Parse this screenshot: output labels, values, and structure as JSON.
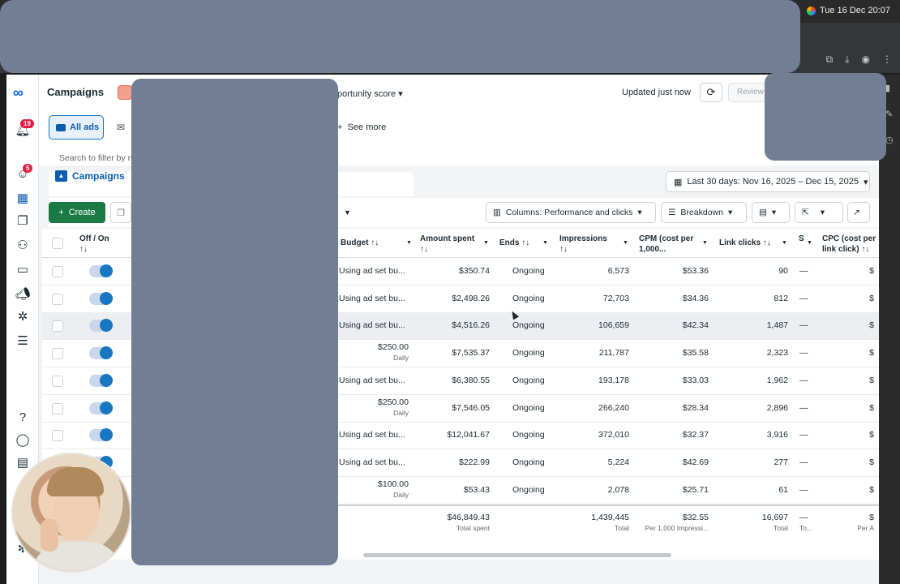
{
  "system": {
    "clock": "Tue 16 Dec  20:07"
  },
  "header": {
    "title": "Campaigns",
    "opportunity_label": "portunity score",
    "updated_label": "Updated just now",
    "review_label": "Review"
  },
  "filters": {
    "all_ads_label": "All ads",
    "see_more_label": "See more",
    "search_placeholder": "Search to filter by n"
  },
  "rail": {
    "notification_count": "19",
    "alerts_count": "5"
  },
  "tabs": {
    "campaigns_label": "Campaigns"
  },
  "date_range": {
    "label": "Last 30 days: Nov 16, 2025 – Dec 15, 2025"
  },
  "toolbar": {
    "create_label": "Create",
    "columns_label": "Columns: Performance and clicks",
    "breakdown_label": "Breakdown"
  },
  "table": {
    "headers": {
      "off_on": "Off / On",
      "budget": "Budget",
      "amount_spent": "Amount spent",
      "ends": "Ends",
      "impressions": "Impressions",
      "cpm": "CPM (cost per 1,000...",
      "link_clicks": "Link clicks",
      "s": "S",
      "cpc": "CPC (cost per link click)"
    },
    "sort_glyph": "↑↓",
    "rows": [
      {
        "budget": "Using ad set bu...",
        "budget_sub": "",
        "amount_spent": "$350.74",
        "ends": "Ongoing",
        "impressions": "6,573",
        "cpm": "$53.36",
        "link_clicks": "90",
        "s": "—",
        "cpc": "$",
        "highlighted": false
      },
      {
        "budget": "Using ad set bu...",
        "budget_sub": "",
        "amount_spent": "$2,498.26",
        "ends": "Ongoing",
        "impressions": "72,703",
        "cpm": "$34.36",
        "link_clicks": "812",
        "s": "—",
        "cpc": "$",
        "highlighted": false
      },
      {
        "budget": "Using ad set bu...",
        "budget_sub": "",
        "amount_spent": "$4,516.26",
        "ends": "Ongoing",
        "impressions": "106,659",
        "cpm": "$42.34",
        "link_clicks": "1,487",
        "s": "—",
        "cpc": "$",
        "highlighted": true
      },
      {
        "budget": "$250.00",
        "budget_sub": "Daily",
        "amount_spent": "$7,535.37",
        "ends": "Ongoing",
        "impressions": "211,787",
        "cpm": "$35.58",
        "link_clicks": "2,323",
        "s": "—",
        "cpc": "$",
        "highlighted": false
      },
      {
        "budget": "Using ad set bu...",
        "budget_sub": "",
        "amount_spent": "$6,380.55",
        "ends": "Ongoing",
        "impressions": "193,178",
        "cpm": "$33.03",
        "link_clicks": "1,962",
        "s": "—",
        "cpc": "$",
        "highlighted": false
      },
      {
        "budget": "$250.00",
        "budget_sub": "Daily",
        "amount_spent": "$7,546.05",
        "ends": "Ongoing",
        "impressions": "266,240",
        "cpm": "$28.34",
        "link_clicks": "2,896",
        "s": "—",
        "cpc": "$",
        "highlighted": false
      },
      {
        "budget": "Using ad set bu...",
        "budget_sub": "",
        "amount_spent": "$12,041.67",
        "ends": "Ongoing",
        "impressions": "372,010",
        "cpm": "$32.37",
        "link_clicks": "3,916",
        "s": "—",
        "cpc": "$",
        "highlighted": false
      },
      {
        "budget": "Using ad set bu...",
        "budget_sub": "",
        "amount_spent": "$222.99",
        "ends": "Ongoing",
        "impressions": "5,224",
        "cpm": "$42.69",
        "link_clicks": "277",
        "s": "—",
        "cpc": "$",
        "highlighted": false
      },
      {
        "budget": "$100.00",
        "budget_sub": "Daily",
        "amount_spent": "$53.43",
        "ends": "Ongoing",
        "impressions": "2,078",
        "cpm": "$25.71",
        "link_clicks": "61",
        "s": "—",
        "cpc": "$",
        "highlighted": false
      }
    ],
    "totals": {
      "amount_spent": "$46,849.43",
      "amount_spent_sub": "Total spent",
      "impressions": "1,439,445",
      "impressions_sub": "Total",
      "cpm": "$32.55",
      "cpm_sub": "Per 1,000 Impressi...",
      "link_clicks": "16,697",
      "link_clicks_sub": "Total",
      "s": "—",
      "s_sub": "To...",
      "cpc": "$",
      "cpc_sub": "Per A"
    }
  }
}
